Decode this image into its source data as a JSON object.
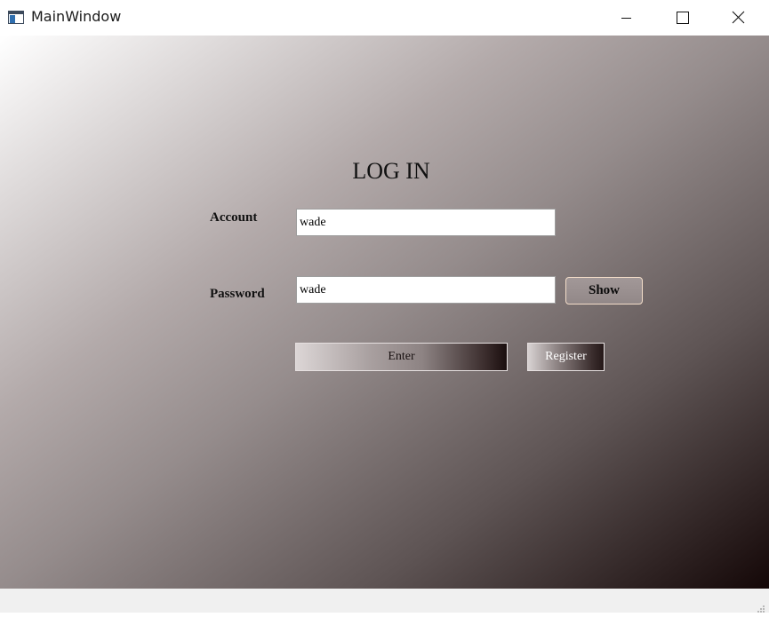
{
  "window": {
    "title": "MainWindow",
    "icons": {
      "app": "window-app-icon",
      "minimize": "minimize-icon",
      "maximize": "maximize-icon",
      "close": "close-icon"
    }
  },
  "login": {
    "heading": "LOG IN",
    "account": {
      "label": "Account",
      "value": "wade"
    },
    "password": {
      "label": "Password",
      "value": "wade"
    },
    "show_label": "Show",
    "enter_label": "Enter",
    "register_label": "Register"
  },
  "status_bar": {
    "icons": {
      "grip": "size-grip-icon"
    }
  },
  "colors": {
    "gradient_light": "#ffffff",
    "gradient_dark": "#140707",
    "show_button_border": "#f3ddc9"
  }
}
